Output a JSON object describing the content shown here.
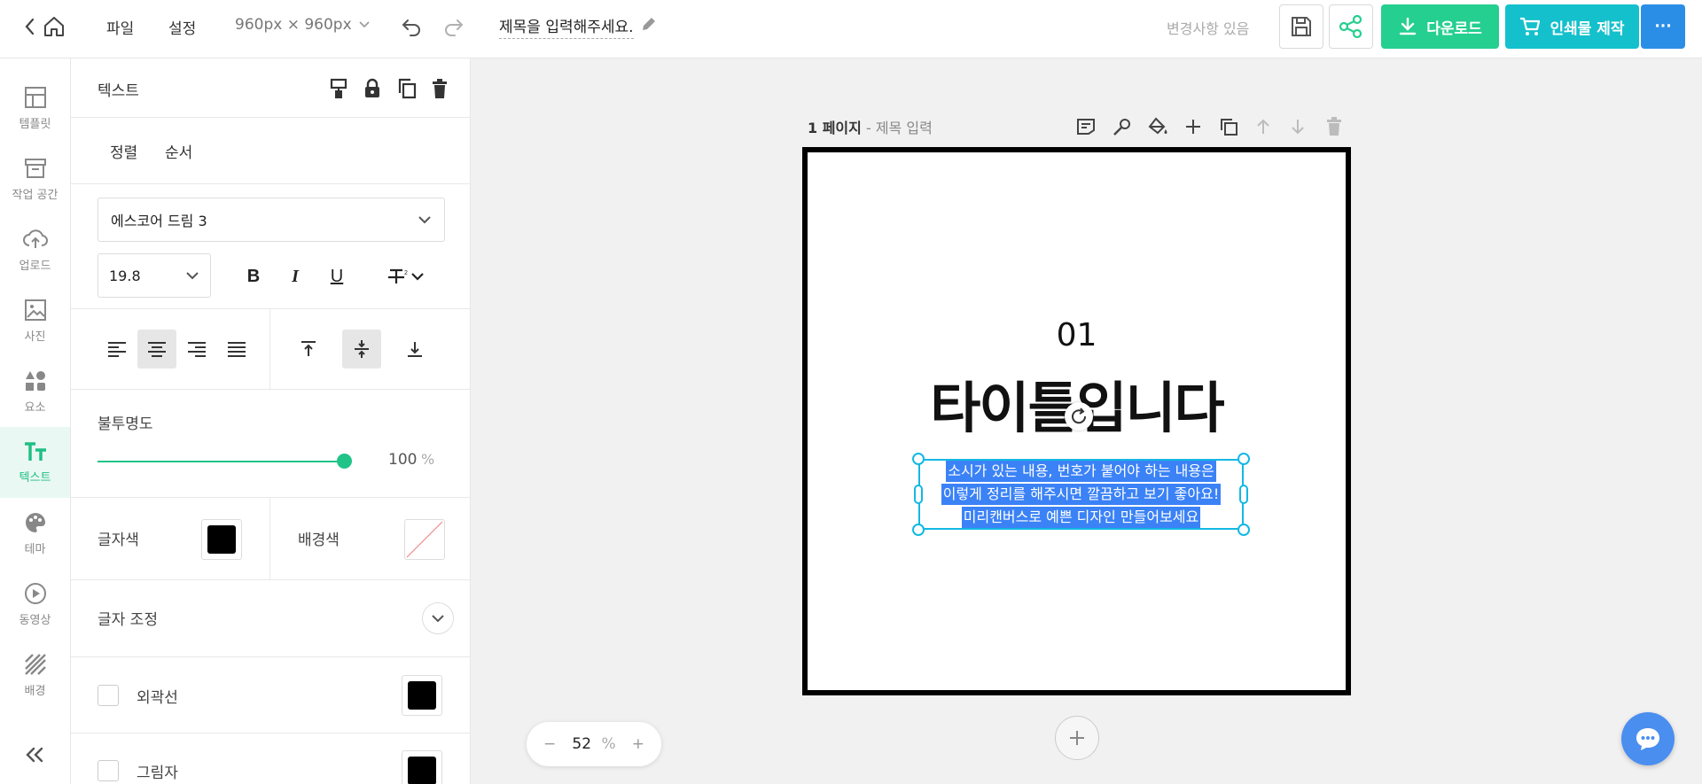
{
  "topbar": {
    "menu_file": "파일",
    "menu_settings": "설정",
    "canvas_size": "960px × 960px",
    "doc_title": "제목을 입력해주세요.",
    "change_status": "변경사항 있음",
    "download_label": "다운로드",
    "print_label": "인쇄물 제작",
    "more_label": "···"
  },
  "nav": {
    "items": [
      {
        "label": "템플릿",
        "icon": "template-icon"
      },
      {
        "label": "작업 공간",
        "icon": "workspace-icon"
      },
      {
        "label": "업로드",
        "icon": "upload-icon"
      },
      {
        "label": "사진",
        "icon": "photo-icon"
      },
      {
        "label": "요소",
        "icon": "elements-icon"
      },
      {
        "label": "텍스트",
        "icon": "text-icon",
        "active": true
      },
      {
        "label": "테마",
        "icon": "theme-icon"
      },
      {
        "label": "동영상",
        "icon": "video-icon"
      },
      {
        "label": "배경",
        "icon": "background-icon"
      }
    ]
  },
  "panel": {
    "title": "텍스트",
    "tabs": [
      "정렬",
      "순서"
    ],
    "font_family": "에스코어 드림 3",
    "font_size": "19.8",
    "bold": "B",
    "italic": "I",
    "underline": "U",
    "opacity_label": "불투명도",
    "opacity_value": "100",
    "opacity_unit": "%",
    "opacity_fraction": 1.0,
    "text_color_label": "글자색",
    "text_color": "#000000",
    "bg_color_label": "배경색",
    "adjust_label": "글자 조정",
    "outline_label": "외곽선",
    "outline_color": "#000000",
    "shadow_label": "그림자",
    "shadow_color": "#000000",
    "active_align": "center",
    "active_valign": "middle"
  },
  "canvas": {
    "page_label_main": "1 페이지",
    "page_label_sub": " - 제목 입력",
    "page_number": "01",
    "heading": "타이틀입니다",
    "body_lines": [
      "소시가 있는 내용, 번호가 붙어야 하는 내용은",
      "이렇게 정리를 해주시면 깔끔하고 보기 좋아요!",
      "미리캔버스로 예쁜 디자인 만들어보세요"
    ]
  },
  "zoom": {
    "minus": "−",
    "value": "52",
    "unit": "%",
    "plus": "+"
  },
  "colors": {
    "accent_green": "#25cf8f",
    "print_teal": "#14c0cc",
    "more_blue": "#2b8ee6",
    "selection": "#13b8e4"
  }
}
